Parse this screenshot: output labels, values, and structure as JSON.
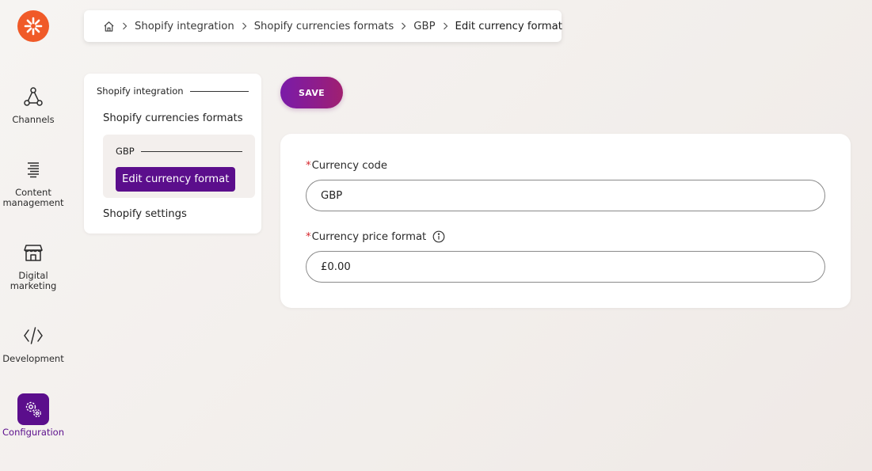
{
  "rail": {
    "items": [
      {
        "label": "Channels",
        "icon": "channels-icon"
      },
      {
        "label": "Content\nmanagement",
        "icon": "content-management-icon"
      },
      {
        "label": "Digital\nmarketing",
        "icon": "digital-marketing-icon"
      },
      {
        "label": "Development",
        "icon": "code-icon"
      },
      {
        "label": "Configuration",
        "icon": "gears-icon",
        "active": true
      }
    ]
  },
  "breadcrumb": {
    "items": [
      "Shopify integration",
      "Shopify currencies formats",
      "GBP"
    ],
    "current": "Edit currency format"
  },
  "tree": {
    "root": "Shopify integration",
    "currencies": "Shopify currencies formats",
    "sub": "GBP",
    "active": "Edit currency format",
    "settings": "Shopify settings"
  },
  "toolbar": {
    "save_label": "SAVE"
  },
  "form": {
    "currency_code": {
      "required_mark": "*",
      "label": "Currency code",
      "value": "GBP"
    },
    "price_format": {
      "required_mark": "*",
      "label": "Currency price format",
      "value": "£0.00"
    }
  },
  "colors": {
    "brand_orange": "#f05a28",
    "accent_purple": "#5b0e8c",
    "required_red": "#d6262d"
  }
}
